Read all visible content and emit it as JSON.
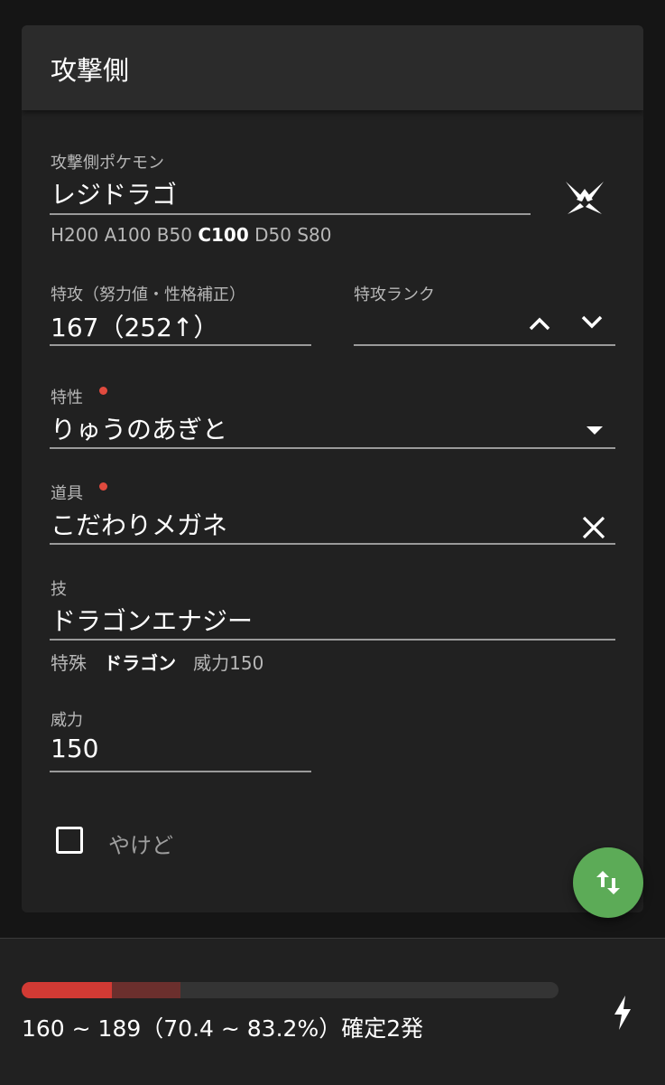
{
  "card": {
    "title": "攻撃側"
  },
  "pokemon": {
    "label": "攻撃側ポケモン",
    "value": "レジドラゴ",
    "stats": {
      "h": "H200",
      "a": "A100",
      "b": "B50",
      "c": "C100",
      "d": "D50",
      "s": "S80"
    },
    "type_icon": "dragon-type-icon"
  },
  "spatk": {
    "label": "特攻（努力値・性格補正）",
    "value": "167（252↑）"
  },
  "rank": {
    "label": "特攻ランク",
    "value": "",
    "up_icon": "chevron-up-icon",
    "down_icon": "chevron-down-icon"
  },
  "ability": {
    "label": "特性",
    "value": "りゅうのあぎと",
    "marker_color": "#e04a3e"
  },
  "item": {
    "label": "道具",
    "value": "こだわりメガネ",
    "marker_color": "#e04a3e"
  },
  "move": {
    "label": "技",
    "value": "ドラゴンエナジー",
    "category": "特殊",
    "type": "ドラゴン",
    "power_text": "威力150"
  },
  "power": {
    "label": "威力",
    "value": "150"
  },
  "burn": {
    "label": "やけど",
    "checked": false
  },
  "fab": {
    "icon": "swap-vertical-icon",
    "color": "#5cab57"
  },
  "result": {
    "text": "160 ~ 189（70.4 ~ 83.2%）確定2発",
    "min_percent": 70.4,
    "max_percent": 83.2,
    "bar_min_color": "#d23a34",
    "bar_range_color": "#6b2f2d",
    "icon": "lightning-bolt-icon"
  }
}
